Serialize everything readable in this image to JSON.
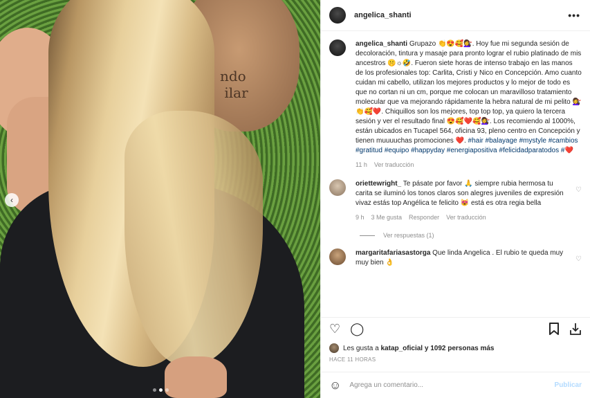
{
  "photo": {
    "plaque_text": "ndo\nilar"
  },
  "post": {
    "username": "angelica_shanti",
    "caption_username": "angelica_shanti",
    "caption": "Grupazo 👏😍🥰💇‍♀️. Hoy fue mi segunda sesión de decoloración, tintura y masaje para pronto lograr el rubio platinado de mis ancestros 🤫☼🤣. Fueron siete horas de intenso trabajo en las manos de los profesionales top: Carlita, Cristi y Nico en Concepción. Amo cuanto cuidan mi cabello, utilizan los mejores productos y lo mejor de todo es que no cortan ni un cm, porque me colocan un maravilloso tratamiento molecular que va mejorando rápidamente la hebra natural de mi pelito 💇‍♀️👏🥰❤️. Chiquillos son los mejores, top top top, ya quiero la tercera sesión y ver el resultado final 😍🥰❤️🥰💇‍♀️. Los recomiendo al 1000%, están ubicados en Tucapel 564, oficina 93, pleno centro en Concepción y tienen muuuuchas promociones ❤️.",
    "hashtags": "#hair #balayage #mystyle #cambios #gratitud #equipo #happyday #energiapositiva #felicidadparatodos #❤️",
    "time": "11 h",
    "translate": "Ver traducción"
  },
  "comments": [
    {
      "username": "oriettewright_",
      "text": "Te pásate por favor 🙏 siempre rubia hermosa tu carita se iluminó los tonos claros son alegres juveniles de expresión vivaz estás top Angélica te felicito 😻 está es otra regia bella",
      "time": "9 h",
      "likes": "3 Me gusta",
      "reply": "Responder",
      "translate": "Ver traducción"
    },
    {
      "username": "margaritafariasastorga",
      "text": "Que linda Angelica . El rubio te queda muy muy bien 👌"
    }
  ],
  "replies_label": "Ver respuestas (1)",
  "likes_text_prefix": "Les gusta a",
  "likes_user": "katap_oficial",
  "likes_text_suffix": "y 1092 personas más",
  "posted_ago": "HACE 11 HORAS",
  "comment_input": {
    "placeholder": "Agrega un comentario..."
  },
  "publish_label": "Publicar",
  "icons": {
    "more": "more-horizontal-icon",
    "like": "heart-icon",
    "comment": "comment-icon",
    "save": "bookmark-icon",
    "share": "share-download-icon",
    "emoji": "emoji-icon"
  },
  "carousel": {
    "slides": 3,
    "active": 2
  }
}
